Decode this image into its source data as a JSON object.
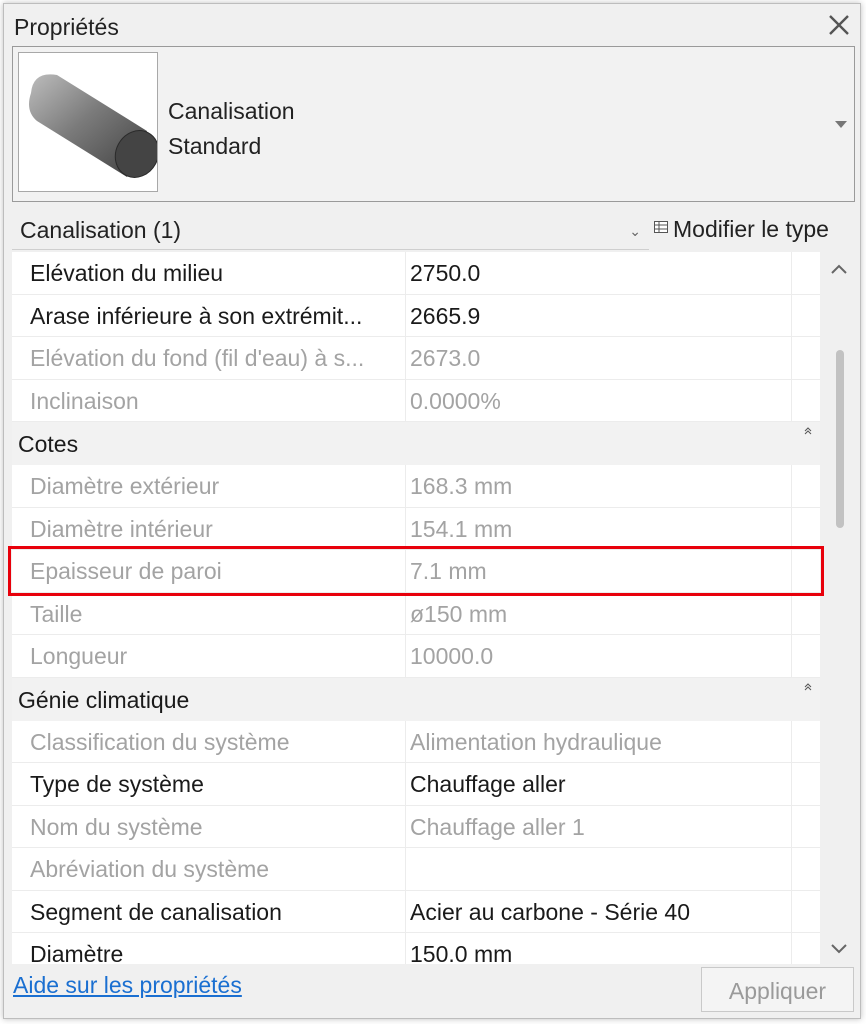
{
  "window": {
    "title": "Propriétés",
    "close_icon": "close-icon"
  },
  "type_selector": {
    "family": "Canalisation",
    "type": "Standard",
    "thumbnail_icon": "pipe-cylinder-icon",
    "dropdown_icon": "caret-down-icon"
  },
  "filter": {
    "selection": "Canalisation (1)",
    "chevron_icon": "chevron-down-icon",
    "edit_type_label": "Modifier le type",
    "edit_type_icon": "edit-type-icon"
  },
  "properties": {
    "top_rows": [
      {
        "label": "Elévation du milieu",
        "value": "2750.0",
        "enabled": true
      },
      {
        "label": "Arase inférieure à son extrémit...",
        "value": "2665.9",
        "enabled": true
      },
      {
        "label": "Elévation du fond (fil d'eau) à s...",
        "value": "2673.0",
        "enabled": false
      },
      {
        "label": "Inclinaison",
        "value": "0.0000%",
        "enabled": false
      }
    ],
    "groups": [
      {
        "name": "Cotes",
        "rows": [
          {
            "label": "Diamètre extérieur",
            "value": "168.3 mm",
            "enabled": false
          },
          {
            "label": "Diamètre intérieur",
            "value": "154.1 mm",
            "enabled": false
          },
          {
            "label": "Epaisseur de paroi",
            "value": "7.1 mm",
            "enabled": false
          },
          {
            "label": "Taille",
            "value": "ø150 mm",
            "enabled": false
          },
          {
            "label": "Longueur",
            "value": "10000.0",
            "enabled": false
          }
        ]
      },
      {
        "name": "Génie climatique",
        "rows": [
          {
            "label": "Classification du système",
            "value": "Alimentation hydraulique",
            "enabled": false
          },
          {
            "label": "Type de système",
            "value": "Chauffage aller",
            "enabled": true
          },
          {
            "label": "Nom du système",
            "value": "Chauffage aller 1",
            "enabled": false
          },
          {
            "label": "Abréviation du système",
            "value": "",
            "enabled": false
          },
          {
            "label": "Segment de canalisation",
            "value": "Acier au carbone - Série 40",
            "enabled": true
          },
          {
            "label": "Diamètre",
            "value": "150.0 mm",
            "enabled": true
          }
        ]
      }
    ]
  },
  "highlight_color": "#e8000b",
  "footer": {
    "help_link": "Aide sur les propriétés",
    "apply_button": "Appliquer"
  }
}
